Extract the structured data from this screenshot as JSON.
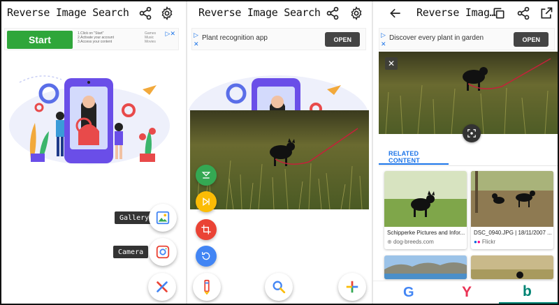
{
  "screen1": {
    "title": "Reverse Image Search",
    "ad": {
      "cta": "Start",
      "lines": [
        "1.Click on \"Start\"",
        "2.Activate your account",
        "3.Access your content"
      ],
      "side": [
        "Games",
        "Music",
        "Movies"
      ]
    },
    "actions": [
      {
        "label": "Gallery",
        "icon": "gallery-icon"
      },
      {
        "label": "Camera",
        "icon": "camera-icon"
      }
    ],
    "close_icon": "close-icon"
  },
  "screen2": {
    "title": "Reverse Image Search",
    "ad": {
      "text": "Plant recognition app",
      "open": "OPEN"
    },
    "tools": [
      "flip-icon",
      "skip-icon",
      "crop-icon",
      "rotate-icon"
    ],
    "bottom": [
      "edit-icon",
      "search-icon",
      "add-icon"
    ]
  },
  "screen3": {
    "title": "Reverse Imag…",
    "ad": {
      "text": "Discover every plant in garden",
      "open": "OPEN"
    },
    "section": "RELATED CONTENT",
    "results": [
      {
        "caption": "Schipperke Pictures and Infor...",
        "source": "dog-breeds.com"
      },
      {
        "caption": "DSC_0940.JPG | 18/11/2007 ...",
        "source": "Flickr"
      }
    ],
    "engines": [
      "G",
      "Y",
      "b"
    ]
  },
  "colors": {
    "accent": "#1a73e8",
    "green": "#34a853",
    "yellow": "#fbbc05",
    "red": "#ea4335",
    "blue": "#4285f4",
    "purple": "#6a4ee8"
  }
}
